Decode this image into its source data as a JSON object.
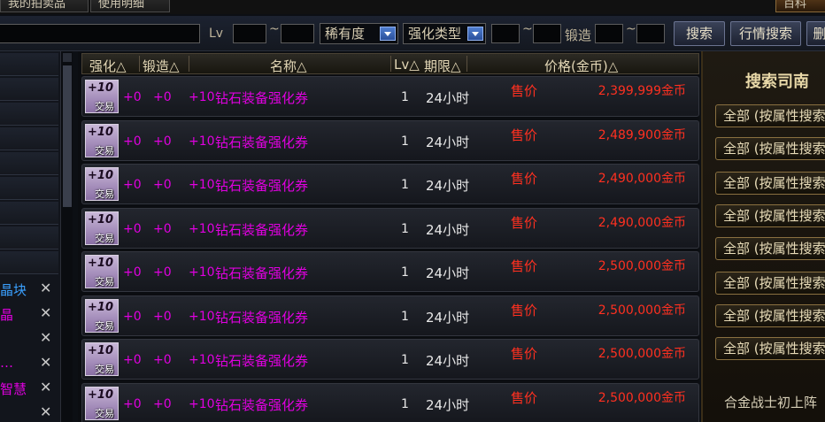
{
  "tabs": [
    "我的拍卖品",
    "使用明细",
    "百科"
  ],
  "filters": {
    "lv_label": "Lv",
    "tilde": "~",
    "rarity": "稀有度",
    "enhance_type": "强化类型",
    "forge_label": "锻造",
    "search_button": "搜索",
    "market_search_button": "行情搜索",
    "extra_button": "删"
  },
  "left_panel": {
    "items": [
      {
        "label": "晶块",
        "close": "✕"
      },
      {
        "label": "晶",
        "close": "✕"
      },
      {
        "label": "",
        "close": "✕"
      },
      {
        "label": "…",
        "close": "✕"
      },
      {
        "label": "智慧",
        "close": "✕"
      },
      {
        "label": "",
        "close": "✕"
      }
    ]
  },
  "table": {
    "headers": {
      "enhance": "强化△",
      "forge": "锻造△",
      "name": "名称△",
      "lv": "Lv△",
      "period": "期限△",
      "price": "价格(金币)△"
    },
    "icon_plus": "+10",
    "icon_trade": "交易",
    "rows": [
      {
        "enhance": "+0",
        "forge": "+0",
        "plus": "+10",
        "name": "钻石装备强化券",
        "lv": "1",
        "period": "24小时",
        "status": "售价",
        "price": "2,399,999金币"
      },
      {
        "enhance": "+0",
        "forge": "+0",
        "plus": "+10",
        "name": "钻石装备强化券",
        "lv": "1",
        "period": "24小时",
        "status": "售价",
        "price": "2,489,900金币"
      },
      {
        "enhance": "+0",
        "forge": "+0",
        "plus": "+10",
        "name": "钻石装备强化券",
        "lv": "1",
        "period": "24小时",
        "status": "售价",
        "price": "2,490,000金币"
      },
      {
        "enhance": "+0",
        "forge": "+0",
        "plus": "+10",
        "name": "钻石装备强化券",
        "lv": "1",
        "period": "24小时",
        "status": "售价",
        "price": "2,490,000金币"
      },
      {
        "enhance": "+0",
        "forge": "+0",
        "plus": "+10",
        "name": "钻石装备强化券",
        "lv": "1",
        "period": "24小时",
        "status": "售价",
        "price": "2,500,000金币"
      },
      {
        "enhance": "+0",
        "forge": "+0",
        "plus": "+10",
        "name": "钻石装备强化券",
        "lv": "1",
        "period": "24小时",
        "status": "售价",
        "price": "2,500,000金币"
      },
      {
        "enhance": "+0",
        "forge": "+0",
        "plus": "+10",
        "name": "钻石装备强化券",
        "lv": "1",
        "period": "24小时",
        "status": "售价",
        "price": "2,500,000金币"
      },
      {
        "enhance": "+0",
        "forge": "+0",
        "plus": "+10",
        "name": "钻石装备强化券",
        "lv": "1",
        "period": "24小时",
        "status": "售价",
        "price": "2,500,000金币"
      }
    ]
  },
  "right_panel": {
    "title": "搜索司南",
    "buttons": [
      "全部 (按属性搜索)",
      "全部 (按属性搜索)",
      "全部 (按属性搜索)",
      "全部 (按属性搜索)",
      "全部 (按属性搜索)",
      "全部 (按属性搜索)",
      "全部 (按属性搜索)",
      "全部 (按属性搜索)"
    ],
    "footer": "合金战士初上阵"
  },
  "colors": {
    "price_red": "#ff3020",
    "magenta": "#e000e0",
    "highlight_blue": "#3aa0ff"
  }
}
